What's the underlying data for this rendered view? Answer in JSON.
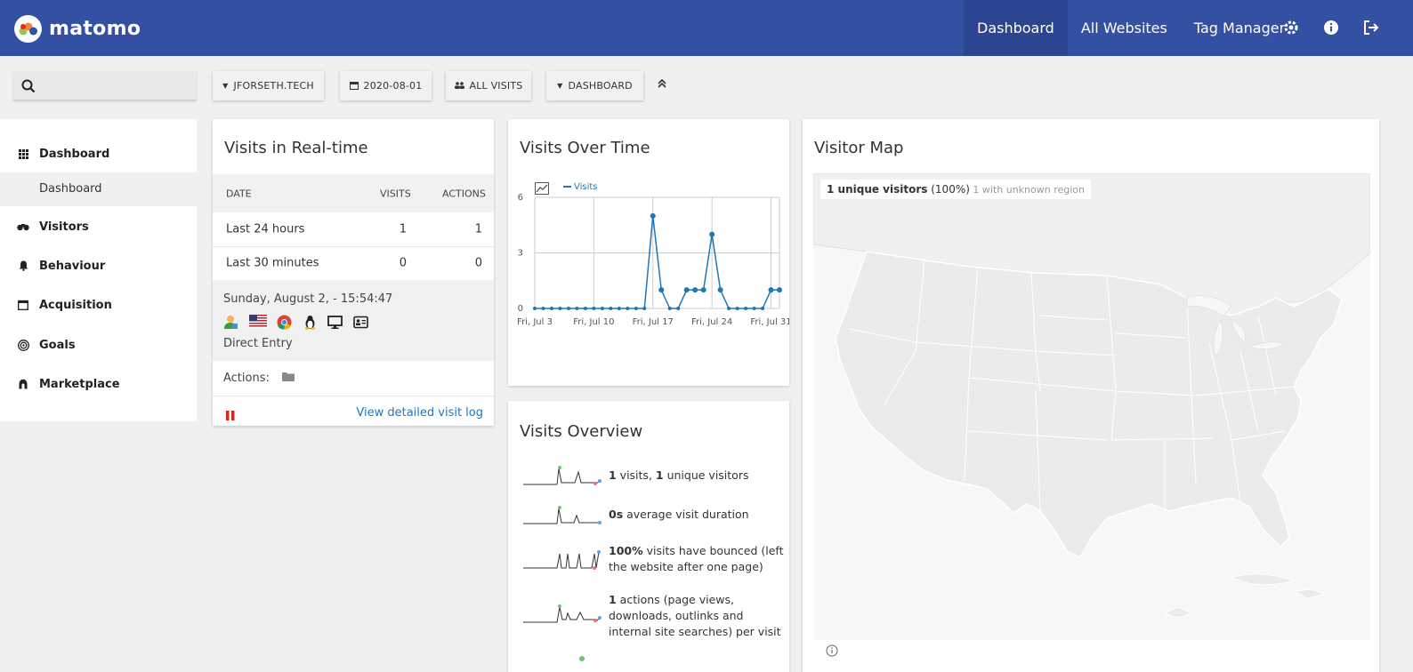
{
  "header": {
    "logo_text": "matomo",
    "nav": [
      "Dashboard",
      "All Websites",
      "Tag Manager"
    ],
    "icons": [
      "gear-icon",
      "info-icon",
      "logout-icon"
    ],
    "bg_color": "#3450a3"
  },
  "toolbar": {
    "site": "JFORSETH.TECH",
    "date": "2020-08-01",
    "segment": "ALL VISITS",
    "dashboard": "DASHBOARD"
  },
  "sidebar": {
    "items": [
      "Dashboard",
      "Visitors",
      "Behaviour",
      "Acquisition",
      "Goals",
      "Marketplace"
    ],
    "sub_item": "Dashboard"
  },
  "realtime": {
    "title": "Visits in Real-time",
    "columns": [
      "DATE",
      "VISITS",
      "ACTIONS"
    ],
    "rows": [
      {
        "label": "Last 24 hours",
        "visits": "1",
        "actions": "1"
      },
      {
        "label": "Last 30 minutes",
        "visits": "0",
        "actions": "0"
      }
    ],
    "visit_time": "Sunday, August 2, - 15:54:47",
    "visit_icons": [
      "visitor-profile-icon",
      "us-flag-icon",
      "chrome-icon",
      "linux-icon",
      "desktop-icon",
      "contact-card-icon"
    ],
    "visit_referrer": "Direct Entry",
    "actions_label": "Actions:",
    "detail_link": "View detailed visit log"
  },
  "visits_over_time": {
    "title": "Visits Over Time",
    "legend": "Visits"
  },
  "chart_data": {
    "type": "line",
    "title": "Visits Over Time",
    "series": [
      {
        "name": "Visits",
        "color": "#1f77b4",
        "values": [
          0,
          0,
          0,
          0,
          0,
          0,
          0,
          0,
          0,
          0,
          0,
          0,
          0,
          0,
          5,
          1,
          0,
          0,
          1,
          1,
          1,
          4,
          1,
          0,
          0,
          0,
          0,
          0,
          1,
          1
        ]
      }
    ],
    "x_tick_labels": [
      "Fri, Jul 3",
      "Fri, Jul 10",
      "Fri, Jul 17",
      "Fri, Jul 24",
      "Fri, Jul 31"
    ],
    "y_ticks": [
      0,
      3,
      6
    ],
    "ylim": [
      0,
      6
    ],
    "grid": true
  },
  "overview": {
    "title": "Visits Overview",
    "items": [
      {
        "value": "1",
        "text": " visits, ",
        "value2": "1",
        "text2": " unique visitors"
      },
      {
        "value": "0s",
        "text": " average visit duration"
      },
      {
        "value": "100%",
        "text": " visits have bounced (left the website after one page)"
      },
      {
        "value": "1",
        "text": " actions (page views, downloads, outlinks and internal site searches) per visit"
      }
    ]
  },
  "map": {
    "title": "Visitor Map",
    "legend_bold": "1 unique visitors",
    "legend_pct": " (100%)",
    "legend_muted": " 1 with unknown region"
  }
}
